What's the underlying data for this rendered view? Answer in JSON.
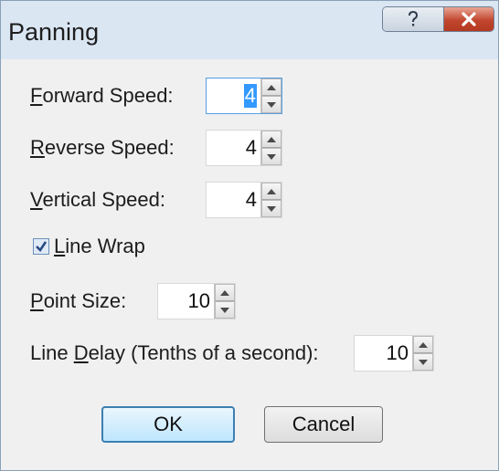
{
  "window": {
    "title": "Panning",
    "help_glyph": "?",
    "close_glyph": "✕"
  },
  "fields": {
    "forward": {
      "label": "Forward Speed:",
      "accel": "F",
      "label_rest": "orward Speed:",
      "value": "4"
    },
    "reverse": {
      "label": "Reverse Speed:",
      "accel": "R",
      "label_rest": "everse Speed:",
      "value": "4"
    },
    "vertical": {
      "label": "Vertical Speed:",
      "accel": "V",
      "label_rest": "ertical Speed:",
      "value": "4"
    },
    "point_size": {
      "label": "Point Size:",
      "accel": "P",
      "label_rest": "oint Size:",
      "value": "10"
    },
    "line_delay": {
      "label": "Line Delay (Tenths of a second):",
      "before": "Line ",
      "accel": "D",
      "label_rest": "elay (Tenths of a second):",
      "value": "10"
    }
  },
  "line_wrap": {
    "label": "Line Wrap",
    "accel": "L",
    "label_rest": "ine Wrap",
    "checked": true
  },
  "buttons": {
    "ok": "OK",
    "cancel": "Cancel"
  },
  "colors": {
    "accent": "#3399ff",
    "titlebar": "#dbe6f3",
    "close_red": "#c2462f"
  },
  "icons": {
    "help": "question-mark-icon",
    "close": "close-icon",
    "spin_up": "up-arrow-icon",
    "spin_down": "down-arrow-icon",
    "check": "checkmark-icon"
  }
}
